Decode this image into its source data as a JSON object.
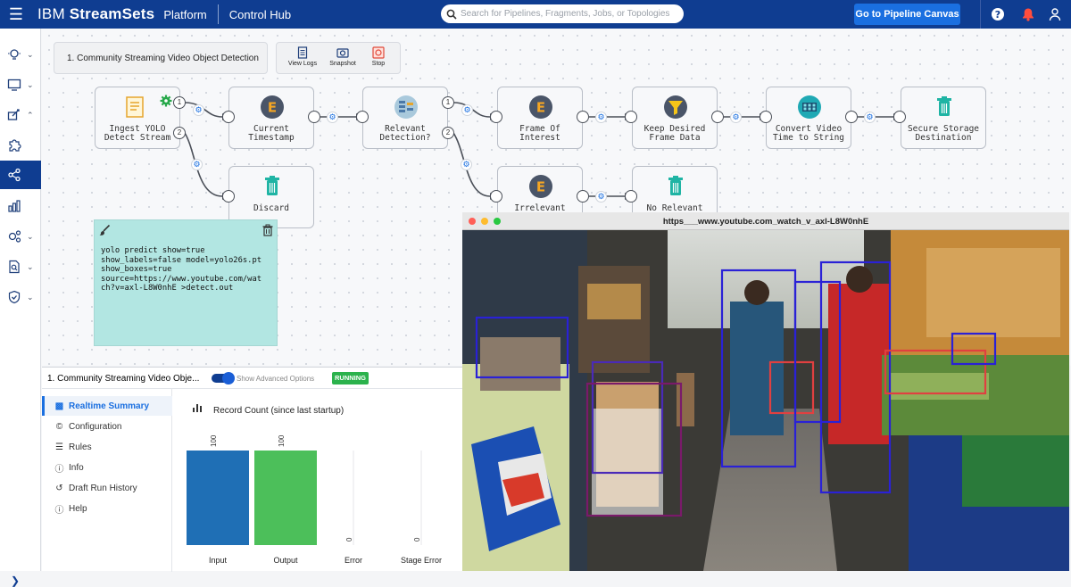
{
  "topbar": {
    "brand_prefix": "IBM",
    "brand_name": "StreamSets",
    "platform": "Platform",
    "product": "Control Hub",
    "search_placeholder": "Search for Pipelines, Fragments, Jobs, or Topologies",
    "canvas_button": "Go to Pipeline Canvas"
  },
  "pipeline": {
    "title": "1. Community Streaming Video Object Detection",
    "toolbar": {
      "view_logs": "View Logs",
      "snapshot": "Snapshot",
      "stop": "Stop"
    },
    "stages": {
      "ingest": {
        "line1": "Ingest YOLO",
        "line2": "Detect Stream"
      },
      "timestamp": {
        "line1": "Current",
        "line2": "Timestamp"
      },
      "relevant": {
        "line1": "Relevant",
        "line2": "Detection?"
      },
      "frame": {
        "line1": "Frame Of",
        "line2": "Interest"
      },
      "keep": {
        "line1": "Keep Desired",
        "line2": "Frame Data"
      },
      "convert": {
        "line1": "Convert Video",
        "line2": "Time to String"
      },
      "secure": {
        "line1": "Secure Storage",
        "line2": "Destination"
      },
      "discard": {
        "line1": "Discard"
      },
      "irrelevant": {
        "line1": "Irrelevant"
      },
      "norelevant": {
        "line1": "No Relevant"
      }
    },
    "ports": {
      "one": "1",
      "two": "2"
    }
  },
  "note": {
    "text": "yolo predict show=true\nshow_labels=false model=yolo26s.pt\nshow_boxes=true\nsource=https://www.youtube.com/wat\nch?v=axl-L8W0nhE >detect.out"
  },
  "panel": {
    "title": "1. Community Streaming Video Obje...",
    "advanced": "Show Advanced Options",
    "status": "RUNNING",
    "menu": [
      "Realtime Summary",
      "Configuration",
      "Rules",
      "Info",
      "Draft Run History",
      "Help"
    ],
    "chart_title": "Record Count (since last startup)"
  },
  "chart_data": {
    "type": "bar",
    "title": "Record Count (since last startup)",
    "categories": [
      "Input",
      "Output",
      "Error",
      "Stage Error"
    ],
    "values": [
      100,
      100,
      0,
      0
    ],
    "colors": [
      "#1f6fb5",
      "#4cbf5a",
      "#777777",
      "#777777"
    ],
    "ylim": [
      0,
      100
    ]
  },
  "video": {
    "title": "https___www.youtube.com_watch_v_axl-L8W0nhE"
  }
}
